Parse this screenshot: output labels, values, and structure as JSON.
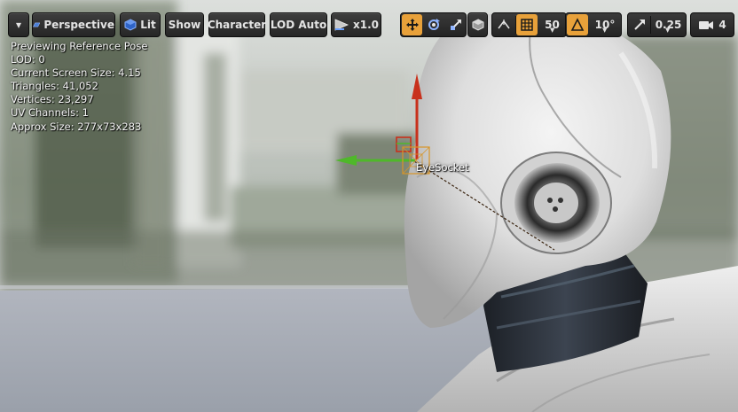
{
  "toolbar": {
    "options_caret": "▾",
    "view_mode_label": "Perspective",
    "lighting_label": "Lit",
    "show_label": "Show",
    "character_label": "Character",
    "lod_label": "LOD Auto",
    "speed_label": "x1.0",
    "grid_snap_value": "50",
    "rotation_snap_value": "10°",
    "scale_snap_value": "0.25",
    "camera_speed_value": "4"
  },
  "stats": {
    "line1": "Previewing Reference Pose",
    "line2": "LOD: 0",
    "line3": "Current Screen Size: 4.15",
    "line4": "Triangles: 41,052",
    "line5": "Vertices: 23,297",
    "line6": "UV Channels: 1",
    "line7": "Approx Size: 277x73x283"
  },
  "socket": {
    "label": "EyeSocket"
  },
  "colors": {
    "accent": "#e8a13a",
    "gizmo_up": "#c8311c",
    "gizmo_side": "#4fb82a",
    "socket_box": "#d89528"
  }
}
